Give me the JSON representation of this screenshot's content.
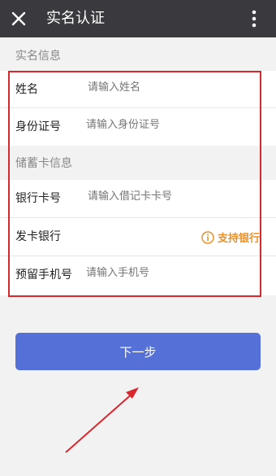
{
  "header": {
    "title": "实名认证",
    "close_icon": "close-icon",
    "menu_icon": "more-vertical-icon"
  },
  "sections": {
    "realname_label": "实名信息",
    "card_label": "储蓄卡信息"
  },
  "fields": {
    "name": {
      "label": "姓名",
      "placeholder": "请输入姓名"
    },
    "id_number": {
      "label": "身份证号",
      "placeholder": "请输入身份证号"
    },
    "card_number": {
      "label": "银行卡号",
      "placeholder": "请输入借记卡卡号"
    },
    "bank": {
      "label": "发卡银行",
      "link": "支持银行",
      "link_icon": "info-icon"
    },
    "phone": {
      "label": "预留手机号",
      "placeholder": "请输入手机号"
    }
  },
  "actions": {
    "next_label": "下一步"
  },
  "colors": {
    "topbar": "#3a3a3e",
    "primary": "#5570d6",
    "highlight": "#d8272d",
    "link": "#e9922b"
  }
}
